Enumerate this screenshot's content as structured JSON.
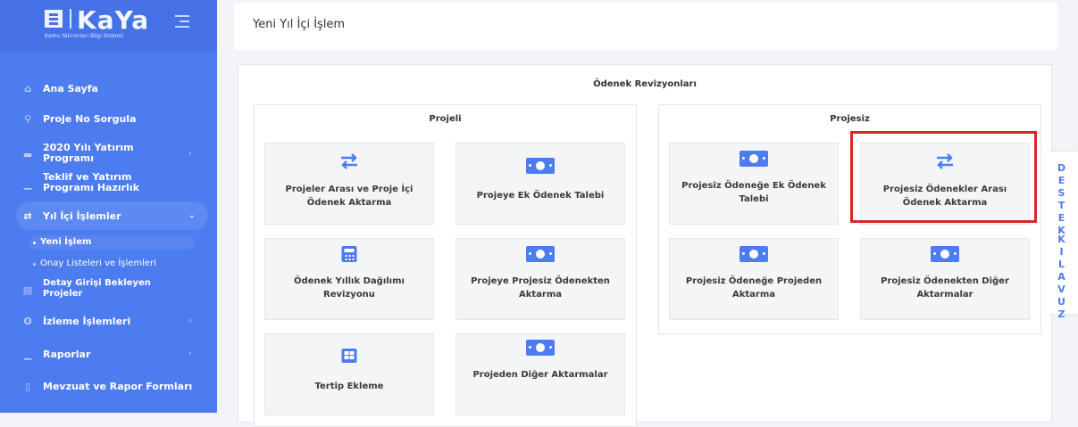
{
  "brand": {
    "name": "KaYa",
    "subtitle": "Kamu Yatırımları Bilgi Sistemi"
  },
  "sidebar": {
    "items": [
      {
        "label": "Ana Sayfa",
        "icon": "home-icon"
      },
      {
        "label": "Proje No Sorgula",
        "icon": "search-icon"
      },
      {
        "label": "2020 Yılı Yatırım Programı",
        "icon": "folder-icon"
      },
      {
        "label": "Teklif ve Yatırım Programı Hazırlık",
        "icon": "chart-icon"
      },
      {
        "label": "Yıl İçi İşlemler",
        "icon": "swap-icon"
      },
      {
        "label": "İzleme İşlemleri",
        "icon": "binoculars-icon"
      },
      {
        "label": "Raporlar",
        "icon": "chart-icon"
      },
      {
        "label": "Mevzuat ve Rapor Formları",
        "icon": "document-icon"
      }
    ],
    "sub_items": [
      {
        "label": "Yeni İşlem"
      },
      {
        "label": "Onay Listeleri ve İşlemleri"
      },
      {
        "label": "Detay Girişi Bekleyen Projeler"
      }
    ]
  },
  "header": {
    "title": "Yeni Yıl İçi İşlem"
  },
  "main": {
    "section_title": "Ödenek Revizyonları",
    "projeli": {
      "title": "Projeli",
      "tiles": [
        {
          "label": "Projeler Arası ve Proje İçi Ödenek Aktarma",
          "icon": "swap-icon"
        },
        {
          "label": "Projeye Ek Ödenek Talebi",
          "icon": "money-icon"
        },
        {
          "label": "Ödenek Yıllık Dağılımı Revizyonu",
          "icon": "calculator-icon"
        },
        {
          "label": "Projeye Projesiz Ödenekten Aktarma",
          "icon": "money-icon"
        },
        {
          "label": "Tertip Ekleme",
          "icon": "grid-icon"
        },
        {
          "label": "Projeden Diğer Aktarmalar",
          "icon": "money-icon"
        }
      ]
    },
    "projesiz": {
      "title": "Projesiz",
      "tiles": [
        {
          "label": "Projesiz Ödeneğe Ek Ödenek Talebi",
          "icon": "money-icon"
        },
        {
          "label": "Projesiz Ödenekler Arası Ödenek Aktarma",
          "icon": "swap-icon"
        },
        {
          "label": "Projesiz Ödeneğe Projeden Aktarma",
          "icon": "money-icon"
        },
        {
          "label": "Projesiz Ödenekten Diğer Aktarmalar",
          "icon": "money-icon"
        }
      ]
    }
  },
  "side_tabs": {
    "support": "DESTEK",
    "guide": "KILAVUZ"
  },
  "colors": {
    "sidebar": "#4d7cf0",
    "accent": "#4d7cf0",
    "highlight": "#d9252a"
  }
}
